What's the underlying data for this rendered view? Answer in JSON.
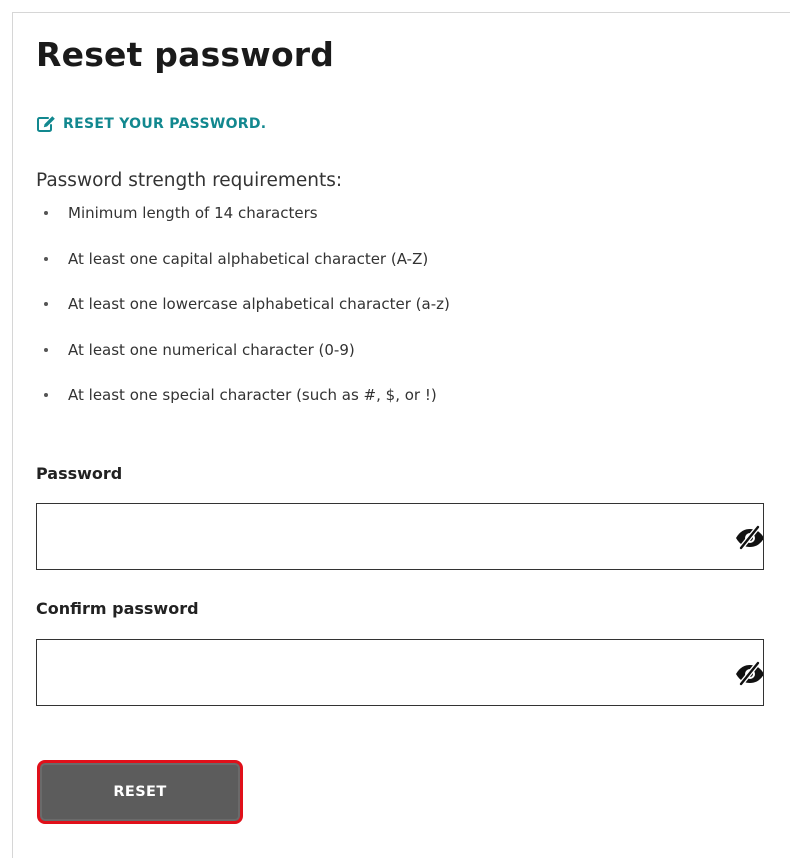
{
  "page": {
    "title": "Reset password"
  },
  "instructions": {
    "icon": "edit-icon",
    "heading": "RESET YOUR PASSWORD.",
    "accent_color": "#12888f"
  },
  "requirements": {
    "title": "Password strength requirements:",
    "items": [
      "Minimum length of 14 characters",
      "At least one capital alphabetical character (A-Z)",
      "At least one lowercase alphabetical character (a-z)",
      "At least one numerical character (0-9)",
      "At least one special character (such as #, $, or !)"
    ]
  },
  "form": {
    "password": {
      "label": "Password",
      "value": "",
      "toggle_icon": "eye-slash-icon"
    },
    "confirm_password": {
      "label": "Confirm password",
      "value": "",
      "toggle_icon": "eye-slash-icon"
    },
    "reset_button": {
      "label": "RESET",
      "background_color": "#5c5c5c",
      "highlight_color": "#e0101a"
    }
  }
}
